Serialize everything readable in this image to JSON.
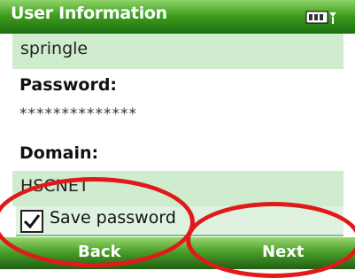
{
  "title_bar": {
    "title": "User Information",
    "battery_icon": "battery-icon"
  },
  "username": {
    "value": "springle"
  },
  "password": {
    "label": "Password:",
    "masked_value": "**************"
  },
  "domain": {
    "label": "Domain:",
    "value": "HSCNET"
  },
  "save_password": {
    "label": "Save password",
    "checked": true,
    "check_icon": "checkmark-icon"
  },
  "softkeys": {
    "left_label": "Back",
    "right_label": "Next"
  },
  "colors": {
    "title_bar": "#3f9f1f",
    "field_background": "#cfeccf",
    "annotation_red": "#e01a1a"
  }
}
